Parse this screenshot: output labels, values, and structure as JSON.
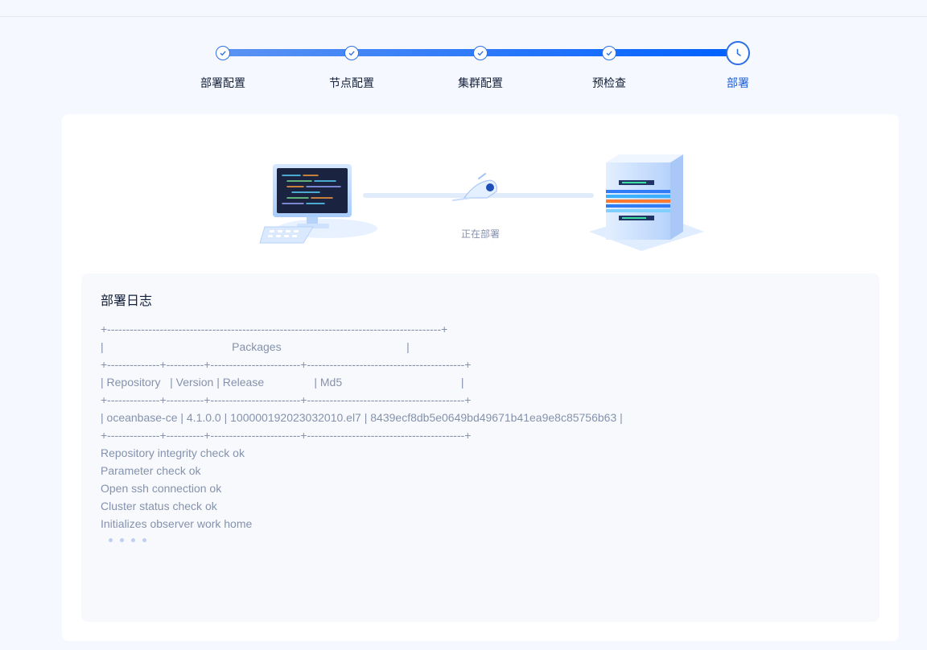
{
  "stepper": {
    "steps": [
      {
        "label": "部署配置",
        "state": "done"
      },
      {
        "label": "节点配置",
        "state": "done"
      },
      {
        "label": "集群配置",
        "state": "done"
      },
      {
        "label": "预检查",
        "state": "done"
      },
      {
        "label": "部署",
        "state": "current"
      }
    ],
    "colors": {
      "track_start": "#5b93f3",
      "track_end": "#0060ff",
      "active_label": "#1a5ed8"
    }
  },
  "deploy": {
    "status_text": "正在部署"
  },
  "log": {
    "title": "部署日志",
    "lines": [
      "+-----------------------------------------------------------------------------------------+",
      "|                                         Packages                                        |",
      "+--------------+----------+------------------------+------------------------------------------+",
      "| Repository   | Version | Release                | Md5                                      |",
      "+--------------+----------+------------------------+------------------------------------------+",
      "| oceanbase-ce | 4.1.0.0 | 100000192023032010.el7 | 8439ecf8db5e0649bd49671b41ea9e8c85756b63 |",
      "+--------------+----------+------------------------+------------------------------------------+",
      "Repository integrity check ok",
      "Parameter check ok",
      "Open ssh connection ok",
      "Cluster status check ok",
      "Initializes observer work home"
    ]
  }
}
